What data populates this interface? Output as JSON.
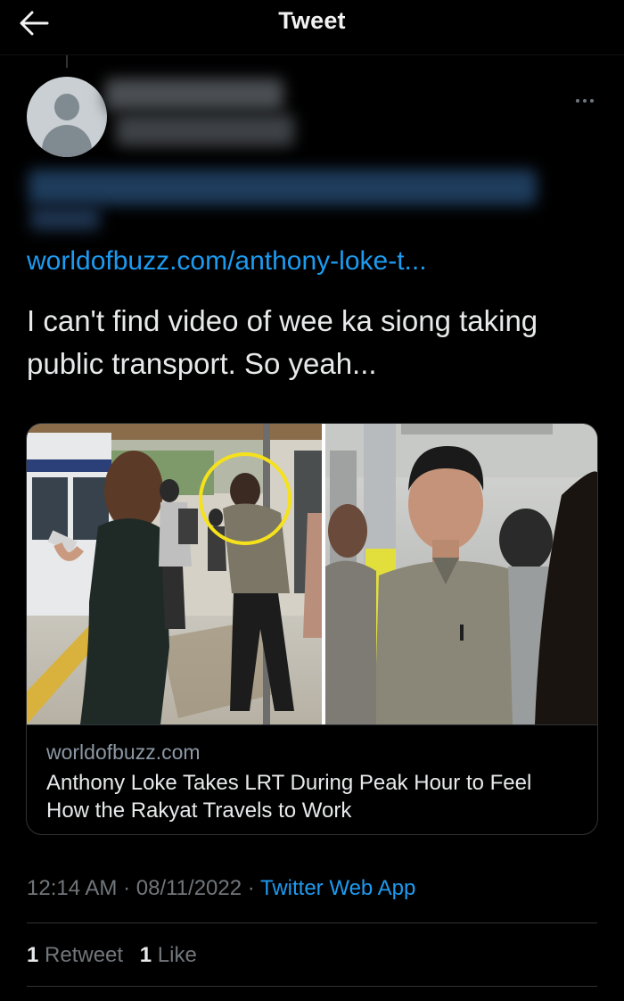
{
  "header": {
    "title": "Tweet",
    "back_icon": "arrow-left-icon"
  },
  "tweet": {
    "more_icon": "more-horizontal-icon",
    "link_text": "worldofbuzz.com/anthony-loke-t...",
    "text": "I can't find video of wee ka siong taking public transport. So yeah...",
    "card": {
      "domain": "worldofbuzz.com",
      "title": "Anthony Loke Takes LRT During Peak Hour to Feel How the Rakyat Travels to Work"
    },
    "time": "12:14 AM",
    "separator": "·",
    "date": "08/11/2022",
    "source": "Twitter Web App",
    "retweets_count": "1",
    "retweets_label": "Retweet",
    "likes_count": "1",
    "likes_label": "Like"
  },
  "colors": {
    "background": "#000000",
    "accent": "#1d9bf0",
    "text": "#e7e9ea",
    "muted": "#71767b",
    "border": "#2f3336"
  }
}
